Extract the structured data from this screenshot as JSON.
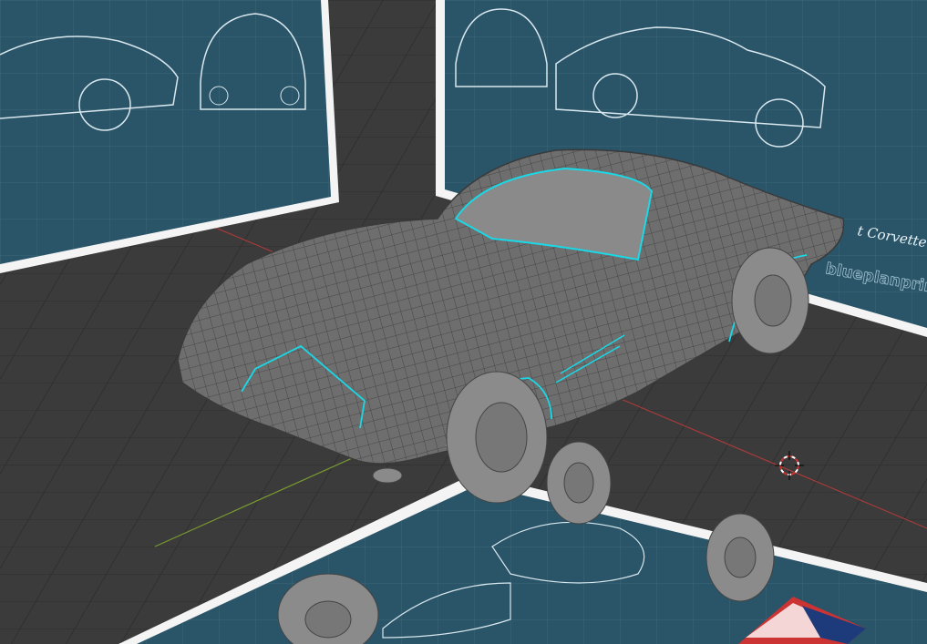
{
  "viewport": {
    "background_color": "#3b3b3b",
    "blueprint_color": "#2a5468",
    "selection_color": "#1ad8e6",
    "x_axis_color": "#a83a3a",
    "y_axis_color": "#7a9a30"
  },
  "blueprint": {
    "title_partial": "t Corvette Sting Ray",
    "brand_partial": "blueplanprints"
  }
}
